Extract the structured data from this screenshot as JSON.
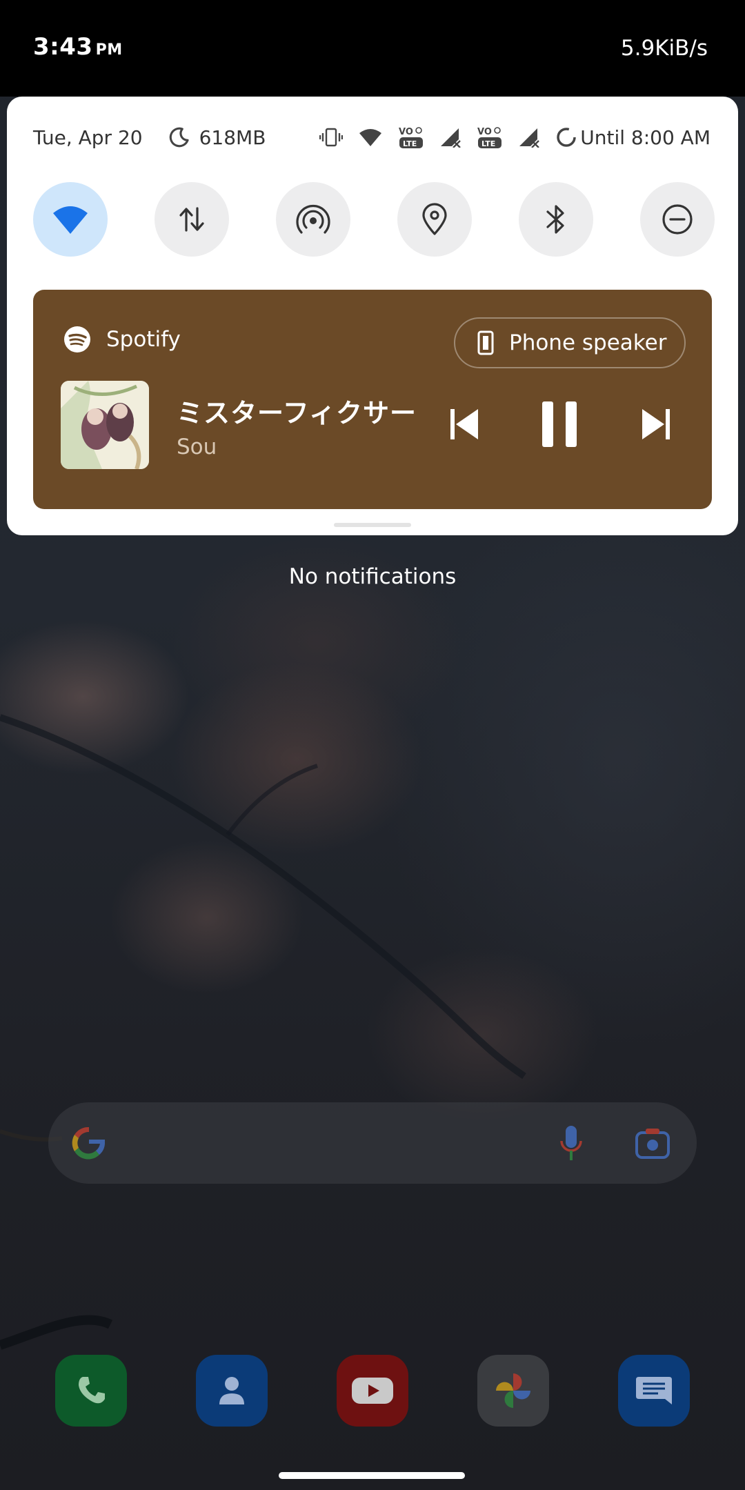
{
  "status_bar": {
    "time": "3:43",
    "ampm": "PM",
    "net_speed": "5.9KiB/s"
  },
  "quick_settings": {
    "date": "Tue, Apr 20",
    "memory": "618MB",
    "alarm_text": "Until 8:00 AM",
    "status_icons": [
      "vibrate-icon",
      "wifi-icon",
      "volte-lte-icon",
      "signal-no-service-icon",
      "volte-lte-icon",
      "signal-no-service-icon",
      "data-saver-icon"
    ],
    "tiles": [
      {
        "name": "wifi",
        "icon": "wifi-icon",
        "active": true
      },
      {
        "name": "mobile-data",
        "icon": "data-transfer-icon",
        "active": false
      },
      {
        "name": "hotspot",
        "icon": "hotspot-icon",
        "active": false
      },
      {
        "name": "location",
        "icon": "location-pin-icon",
        "active": false
      },
      {
        "name": "bluetooth",
        "icon": "bluetooth-icon",
        "active": false
      },
      {
        "name": "do-not-disturb",
        "icon": "do-not-disturb-icon",
        "active": false
      }
    ],
    "colors": {
      "active_tile": "#cfe6fb",
      "accent": "#1a73e8"
    }
  },
  "media": {
    "app_name": "Spotify",
    "output": "Phone speaker",
    "title": "ミスターフィクサー",
    "artist": "Sou",
    "state": "playing",
    "background": "#6b4a27"
  },
  "notifications": {
    "empty_text": "No notifications"
  },
  "home": {
    "dock": [
      "phone-icon",
      "contacts-icon",
      "youtube-icon",
      "photos-icon",
      "messages-icon"
    ]
  }
}
